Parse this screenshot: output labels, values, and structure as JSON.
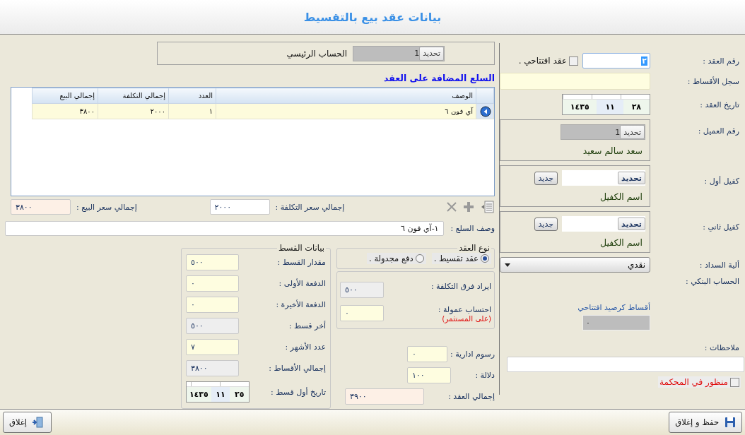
{
  "window": {
    "title": "بيانات عقد بيع بالتقسيط"
  },
  "contract": {
    "number_label": "رقم العقد :",
    "number": "٢",
    "opening_checkbox": {
      "label": "عقد افتتاحي .",
      "checked": false
    },
    "record_label": "سجل الأقساط :",
    "date_label": "تاريخ العقد :",
    "date": {
      "day": "٢٨",
      "month": "١١",
      "year": "١٤٣٥"
    },
    "customer": {
      "label": "رقم العميل :",
      "button": "تحديد",
      "value": "1",
      "name": "سعد سالم سعيد"
    },
    "guarantors": [
      {
        "label": "كفيل أول :",
        "select_button": "تحديد",
        "new_button": "جديد",
        "name": "اسم الكفيل"
      },
      {
        "label": "كفيل ثاني :",
        "select_button": "تحديد",
        "new_button": "جديد",
        "name": "اسم الكفيل"
      }
    ],
    "payment_method": {
      "label": "ألية السداد :",
      "value": "نقدي"
    },
    "bank_account_label": "الحساب البنكي :",
    "opening_balance": {
      "label": "أقساط كرصيد افتتاحي",
      "value": "٠"
    },
    "notes_label": "ملاحظات :",
    "court_checkbox": {
      "label": "منظور في المحكمة",
      "checked": false
    }
  },
  "main_account": {
    "label": "الحساب الرئيسي",
    "button": "تحديد",
    "value": "1"
  },
  "items_title": "السلع المضافة على العقد",
  "table": {
    "columns": [
      "الوصف",
      "العدد",
      "إجمالي التكلفة",
      "إجمالي البيع"
    ],
    "rows": [
      {
        "selected": true,
        "cells": [
          "آي فون ٦",
          "١",
          "٢٠٠٠",
          "٣٨٠٠"
        ]
      }
    ]
  },
  "totals": {
    "cost_label": "إجمالي سعر التكلفة :",
    "cost": "٢٠٠٠",
    "sale_label": "إجمالي سعر البيع :",
    "sale": "٣٨٠٠"
  },
  "items_description": {
    "label": "وصف السلع :",
    "value": "١-آي فون ٦"
  },
  "contract_type": {
    "title": "نوع العقد",
    "options": [
      {
        "label": "عقد تقسيط .",
        "selected": true
      },
      {
        "label": "دفع مجدولة .",
        "selected": false
      }
    ]
  },
  "cost_difference": {
    "label": "ايراد فرق التكلفة :",
    "value": "٥٠٠"
  },
  "commission": {
    "label": "احتساب عمولة :",
    "value": "٠",
    "note": "(على المستثمر)"
  },
  "fees": [
    {
      "label": "رسوم ادارية :",
      "value": "٠",
      "kind": "input"
    },
    {
      "label": "دلالة :",
      "value": "١٠٠",
      "kind": "input"
    },
    {
      "label": "إجمالي العقد :",
      "value": "٣٩٠٠",
      "kind": "total"
    }
  ],
  "installment": {
    "title": "بيانات القسط",
    "fields": [
      {
        "label": "مقدار القسط :",
        "value": "٥٠٠",
        "kind": "input"
      },
      {
        "label": "الدفعة الأولى :",
        "value": "٠",
        "kind": "input"
      },
      {
        "label": "الدفعة الأخيرة :",
        "value": "٠",
        "kind": "input"
      },
      {
        "label": "أخر قسط :",
        "value": "٥٠٠",
        "kind": "readonly"
      },
      {
        "label": "عدد الأشهر :",
        "value": "٧",
        "kind": "input"
      },
      {
        "label": "إجمالي الأقساط :",
        "value": "٣٨٠٠",
        "kind": "readonly"
      }
    ],
    "first_date_label": "تاريخ أول قسط :",
    "first_date": {
      "day": "٢٥",
      "month": "١١",
      "year": "١٤٣٥"
    }
  },
  "footer": {
    "save_button": "حفظ و إغلاق",
    "close_button": "إغلاق"
  }
}
